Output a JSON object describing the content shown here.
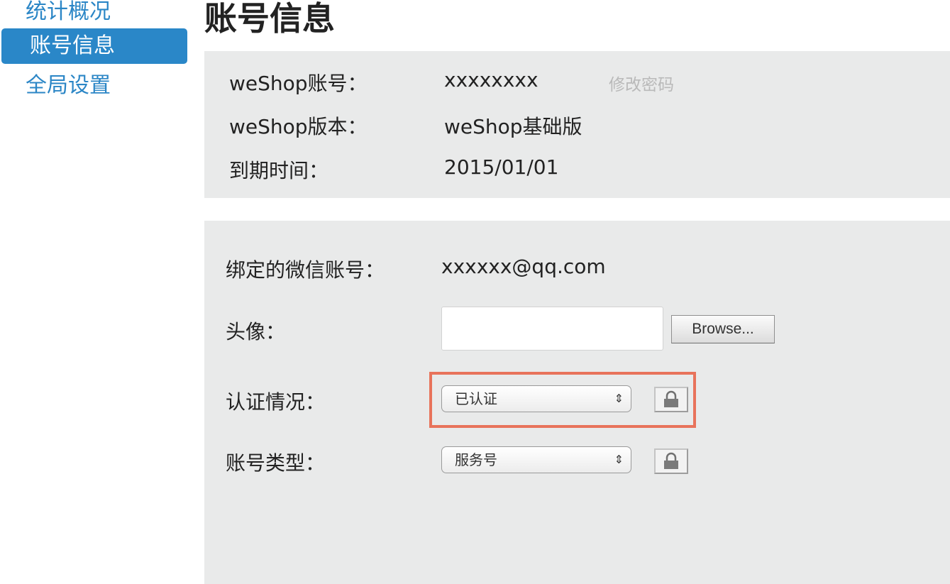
{
  "sidebar": {
    "items": [
      {
        "label": "统计概况"
      },
      {
        "label": "账号信息"
      },
      {
        "label": "全局设置"
      }
    ]
  },
  "page_title": "账号信息",
  "account_panel": {
    "account_label": "weShop账号：",
    "account_value": "xxxxxxxx",
    "change_password": "修改密码",
    "version_label": "weShop版本：",
    "version_value": "weShop基础版",
    "expire_label": "到期时间：",
    "expire_value": "2015/01/01"
  },
  "binding_panel": {
    "wechat_label": "绑定的微信账号：",
    "wechat_value": "xxxxxx@qq.com",
    "avatar_label": "头像：",
    "browse_label": "Browse...",
    "auth_label": "认证情况：",
    "auth_value": "已认证",
    "type_label": "账号类型：",
    "type_value": "服务号"
  },
  "colors": {
    "accent": "#2a87c8",
    "panel_bg": "#e9eaea",
    "highlight": "#e8735b"
  }
}
